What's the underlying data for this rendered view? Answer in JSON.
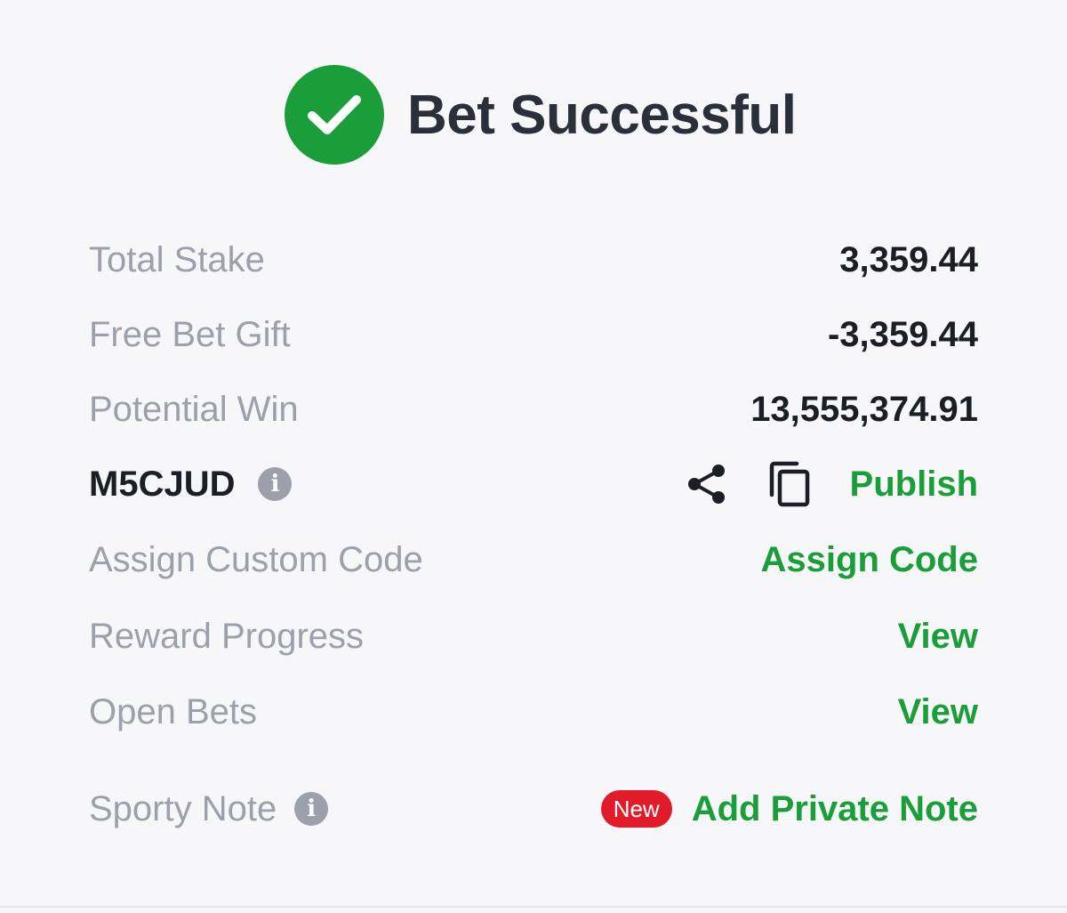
{
  "colors": {
    "success_green": "#1a9e3a",
    "link_green": "#1a9e3a",
    "new_badge_red": "#e21b2b"
  },
  "header": {
    "icon": "check-circle-icon",
    "title": "Bet Successful"
  },
  "summary": {
    "total_stake_label": "Total Stake",
    "total_stake_value": "3,359.44",
    "free_bet_gift_label": "Free Bet Gift",
    "free_bet_gift_value": "-3,359.44",
    "potential_win_label": "Potential Win",
    "potential_win_value": "13,555,374.91"
  },
  "booking": {
    "code": "M5CJUD",
    "info_icon": "info-icon",
    "share_icon": "share-icon",
    "copy_icon": "copy-icon",
    "publish_label": "Publish"
  },
  "custom_code": {
    "label": "Assign Custom Code",
    "action": "Assign Code"
  },
  "reward_progress": {
    "label": "Reward Progress",
    "action": "View"
  },
  "open_bets": {
    "label": "Open Bets",
    "action": "View"
  },
  "sporty_note": {
    "label": "Sporty Note",
    "info_icon": "info-icon",
    "badge": "New",
    "action": "Add Private Note"
  }
}
